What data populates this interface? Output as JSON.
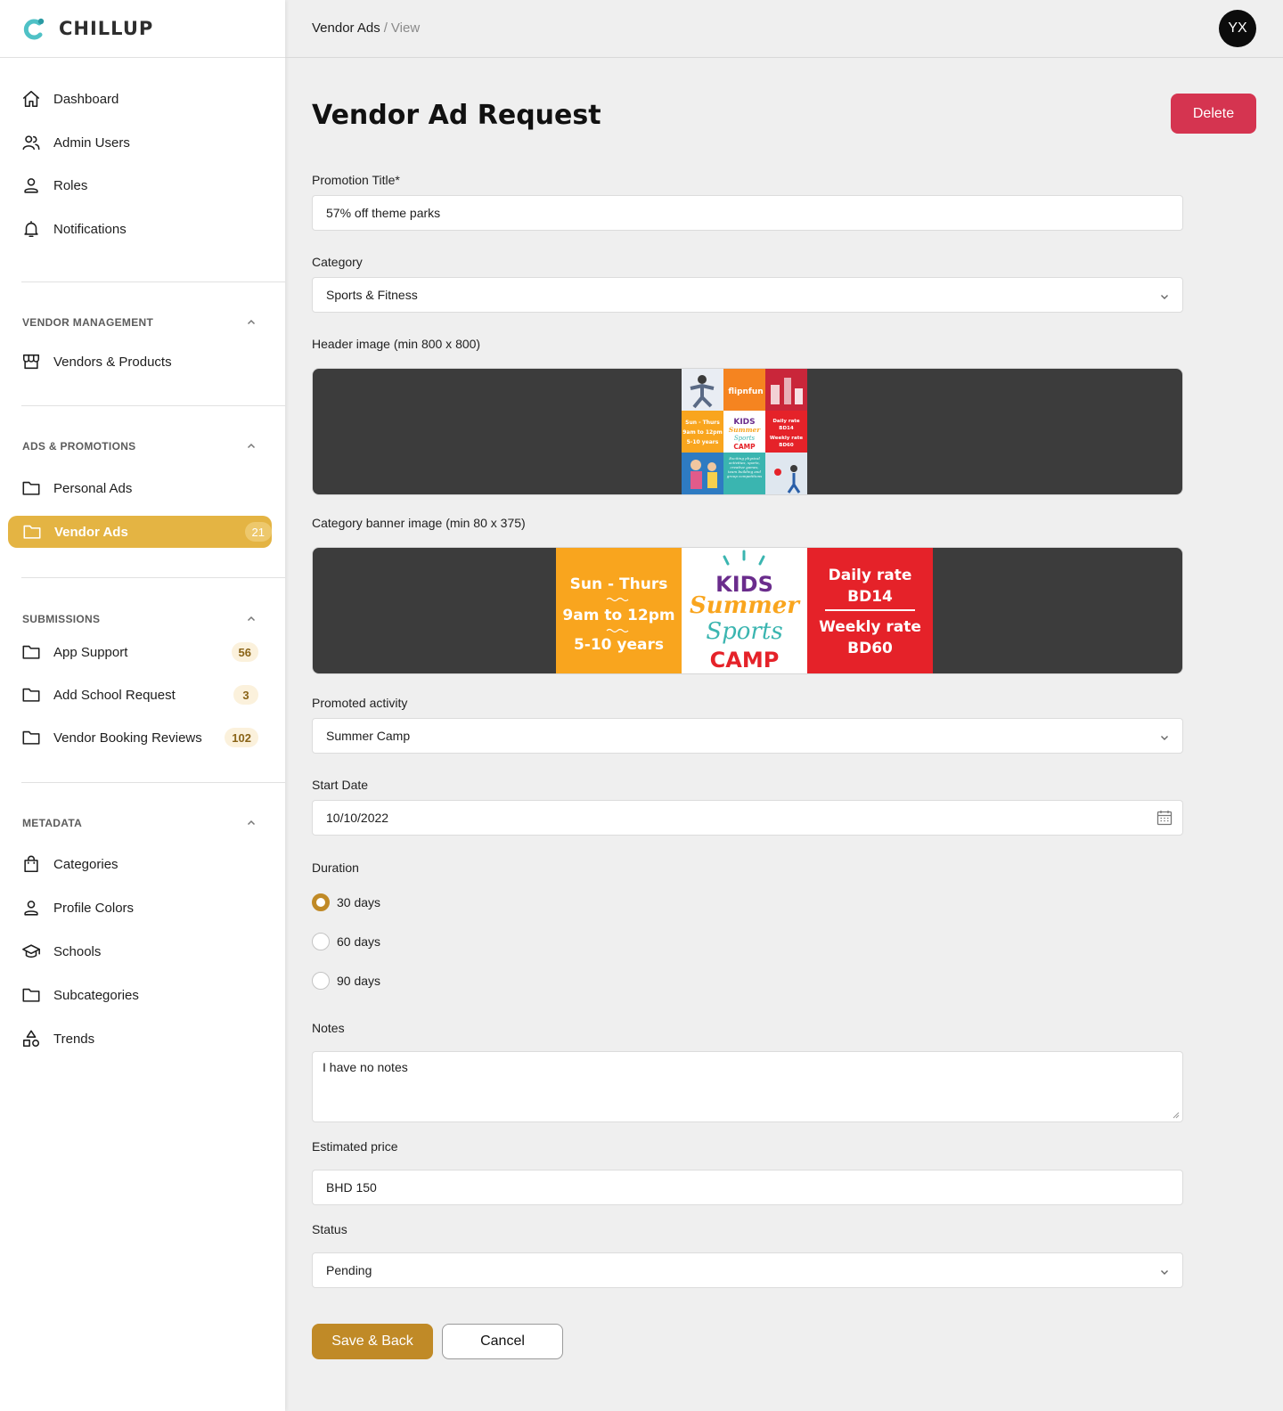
{
  "app": {
    "name": "CHILLUP"
  },
  "sidebar": {
    "top_items": [
      {
        "label": "Dashboard",
        "icon": "home-icon"
      },
      {
        "label": "Admin Users",
        "icon": "users-icon"
      },
      {
        "label": "Roles",
        "icon": "person-icon"
      },
      {
        "label": "Notifications",
        "icon": "bell-icon"
      }
    ],
    "sections": [
      {
        "title": "VENDOR MANAGEMENT",
        "items": [
          {
            "label": "Vendors & Products",
            "icon": "store-icon"
          }
        ]
      },
      {
        "title": "ADS & PROMOTIONS",
        "items": [
          {
            "label": "Personal Ads",
            "icon": "folder-icon"
          },
          {
            "label": "Vendor Ads",
            "icon": "folder-icon",
            "badge": "21",
            "active": true
          }
        ]
      },
      {
        "title": "SUBMISSIONS",
        "items": [
          {
            "label": "App Support",
            "icon": "folder-icon",
            "badge": "56"
          },
          {
            "label": "Add School Request",
            "icon": "folder-icon",
            "badge": "3"
          },
          {
            "label": "Vendor Booking Reviews",
            "icon": "folder-icon",
            "badge": "102"
          }
        ]
      },
      {
        "title": "METADATA",
        "items": [
          {
            "label": "Categories",
            "icon": "bag-icon"
          },
          {
            "label": "Profile Colors",
            "icon": "person-icon"
          },
          {
            "label": "Schools",
            "icon": "graduation-cap-icon"
          },
          {
            "label": "Subcategories",
            "icon": "folder-icon"
          },
          {
            "label": "Trends",
            "icon": "shapes-icon"
          }
        ]
      }
    ]
  },
  "topbar": {
    "breadcrumb_parent": "Vendor Ads",
    "breadcrumb_sep": "/",
    "breadcrumb_current": "View",
    "avatar_initials": "YX"
  },
  "page": {
    "title": "Vendor Ad Request",
    "delete_label": "Delete"
  },
  "form": {
    "promotion_title": {
      "label": "Promotion Title*",
      "value": "57% off theme parks"
    },
    "category": {
      "label": "Category",
      "value": "Sports & Fitness"
    },
    "header_image": {
      "label": "Header image (min 800 x 800)",
      "tiles": [
        "flipnfun",
        "Sun - Thurs",
        "9am to 12pm",
        "5-10 years",
        "KIDS",
        "Summer",
        "Sports",
        "CAMP",
        "Daily rate",
        "BD14",
        "Weekly rate",
        "BD60",
        "Exciting physical activities, sports, creative games, team building and group competitions"
      ]
    },
    "banner_image": {
      "label": "Category banner image (min 80 x 375)",
      "left": [
        "Sun - Thurs",
        "9am to 12pm",
        "5-10 years"
      ],
      "center": [
        "KIDS",
        "Summer",
        "Sports",
        "CAMP"
      ],
      "right": [
        "Daily rate",
        "BD14",
        "Weekly rate",
        "BD60"
      ]
    },
    "promoted_activity": {
      "label": "Promoted activity",
      "value": "Summer Camp"
    },
    "start_date": {
      "label": "Start Date",
      "value": "10/10/2022"
    },
    "duration": {
      "label": "Duration",
      "options": [
        "30 days",
        "60 days",
        "90 days"
      ],
      "selected": "30 days"
    },
    "notes": {
      "label": "Notes",
      "value": "I have no notes"
    },
    "estimated_price": {
      "label": "Estimated price",
      "value": "BHD 150"
    },
    "status": {
      "label": "Status",
      "value": "Pending"
    },
    "save_label": "Save & Back",
    "cancel_label": "Cancel"
  },
  "colors": {
    "accent": "#E4B443",
    "primary_button": "#C08A27",
    "danger": "#D53450",
    "sidebar_bg": "#FFFFFF",
    "content_bg": "#EFEFEF",
    "banner_orange": "#F9A51E",
    "banner_red": "#E52229",
    "banner_purple": "#6A2C8C",
    "banner_teal": "#3AB5B0"
  }
}
